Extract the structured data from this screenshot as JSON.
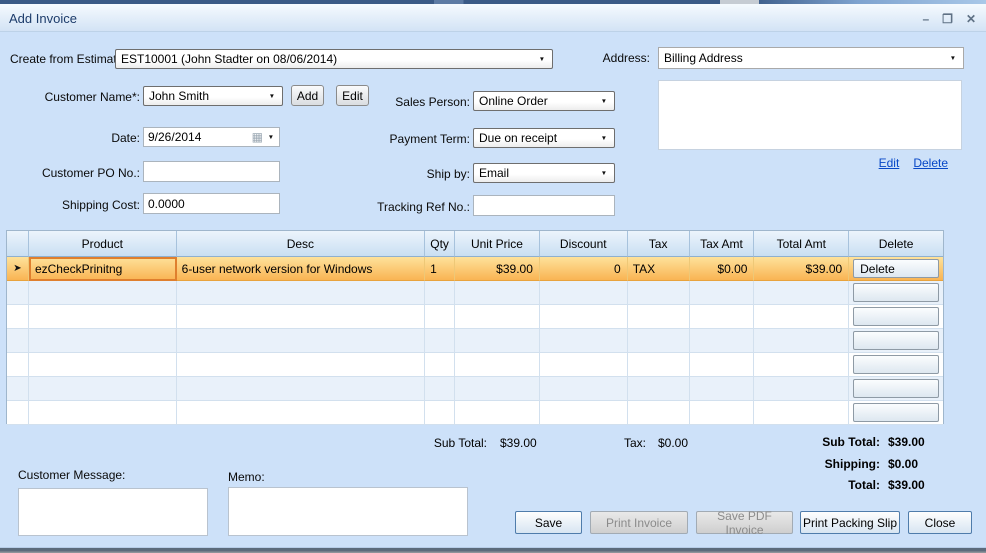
{
  "window": {
    "title": "Add Invoice",
    "controls": {
      "minimize_glyph": "–",
      "maximize_glyph": "❐",
      "close_glyph": "✕"
    }
  },
  "icons": {
    "dropdown_arrow": "▼",
    "calendar": "▦",
    "row_selector": "➤"
  },
  "form": {
    "create_from_estimate": {
      "label": "Create from Estimate:",
      "value": "EST10001 (John Stadter on 08/06/2014)"
    },
    "address": {
      "label": "Address:",
      "value": "Billing Address",
      "edit_link": "Edit",
      "delete_link": "Delete"
    },
    "customer_name": {
      "label": "Customer Name*:",
      "value": "John Smith",
      "add_button": "Add",
      "edit_button": "Edit"
    },
    "sales_person": {
      "label": "Sales Person:",
      "value": "Online Order"
    },
    "date": {
      "label": "Date:",
      "value": "9/26/2014"
    },
    "payment_term": {
      "label": "Payment Term:",
      "value": "Due on receipt"
    },
    "customer_po": {
      "label": "Customer PO No.:",
      "value": ""
    },
    "ship_by": {
      "label": "Ship by:",
      "value": "Email"
    },
    "shipping_cost": {
      "label": "Shipping Cost:",
      "value": "0.0000"
    },
    "tracking_ref": {
      "label": "Tracking Ref No.:",
      "value": ""
    }
  },
  "grid": {
    "columns": [
      "Product",
      "Desc",
      "Qty",
      "Unit Price",
      "Discount",
      "Tax",
      "Tax Amt",
      "Total Amt",
      "Delete"
    ],
    "rows": [
      {
        "product": "ezCheckPrinitng",
        "desc": "6-user network version for Windows",
        "qty": "1",
        "unit_price": "$39.00",
        "discount": "0",
        "tax": "TAX",
        "tax_amt": "$0.00",
        "total_amt": "$39.00",
        "delete_label": "Delete"
      }
    ],
    "empty_row_count": 6
  },
  "totals": {
    "grid_sub_total_label": "Sub Total:",
    "grid_sub_total": "$39.00",
    "grid_tax_label": "Tax:",
    "grid_tax": "$0.00",
    "summary": [
      {
        "label": "Sub Total:",
        "value": "$39.00"
      },
      {
        "label": "Shipping:",
        "value": "$0.00"
      },
      {
        "label": "Total:",
        "value": "$39.00"
      }
    ]
  },
  "bottom": {
    "customer_message_label": "Customer Message:",
    "memo_label": "Memo:",
    "buttons": [
      {
        "label": "Save",
        "enabled": true
      },
      {
        "label": "Print Invoice",
        "enabled": false
      },
      {
        "label": "Save PDF Invoice",
        "enabled": false
      },
      {
        "label": "Print Packing Slip",
        "enabled": true
      },
      {
        "label": "Close",
        "enabled": true
      }
    ]
  },
  "colors": {
    "dialog_bg": "#cde1f9",
    "titlebar_top": "#f5fafe",
    "titlebar_bottom": "#d3e3f5",
    "title_text": "#1d3c6b",
    "selected_row_top": "#fee29b",
    "selected_row_bottom": "#f9b250",
    "selected_cell_border": "#df7f2e",
    "grid_header_top": "#ecf4fc",
    "grid_header_bottom": "#c8def2",
    "link_blue": "#0747c7",
    "button_border_blue": "#4f7cab",
    "disabled_text": "#8b8b8b"
  }
}
